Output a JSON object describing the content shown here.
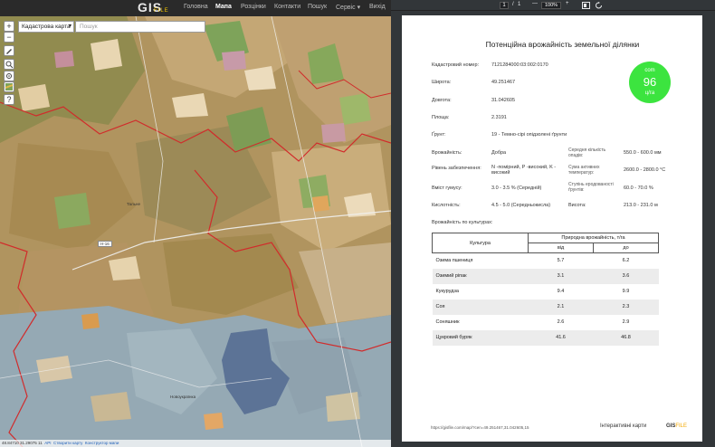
{
  "nav": {
    "logo_main": "GIS",
    "logo_sub": "FILE",
    "items": [
      {
        "label": "Головна"
      },
      {
        "label": "Мапа"
      },
      {
        "label": "Розцінки"
      },
      {
        "label": "Контакти"
      },
      {
        "label": "Пошук"
      },
      {
        "label": "Сервіс"
      },
      {
        "label": "Вихід"
      }
    ],
    "service_chevron": "▾"
  },
  "map": {
    "layer_select": "Кадастрова карта",
    "search_placeholder": "Пошук",
    "zoom_in": "+",
    "zoom_out": "−",
    "help": "?",
    "road_label": "Н-16",
    "place_labels": [
      "Тальне",
      "Новоукраїнка"
    ],
    "attribution": {
      "coords": "48.84710 31.29075 11",
      "api": "API",
      "create_map": "Створити карту",
      "builder": "Конструктор мапи"
    }
  },
  "pdf_toolbar": {
    "page_current": "1",
    "page_sep": "/",
    "page_total": "1",
    "zoom_minus": "—",
    "zoom": "100%",
    "zoom_plus": "+"
  },
  "report": {
    "title": "Потенційна врожайність земельної ділянки",
    "cadastral_label": "Кадастровий номер:",
    "cadastral_value": "7121284000:03:002:0170",
    "lat_label": "Широта:",
    "lat_value": "49.251467",
    "lon_label": "Довгота:",
    "lon_value": "31.042605",
    "area_label": "Площа:",
    "area_value": "2.3191",
    "soil_label": "Ґрунт:",
    "soil_value": "19 - Темно-сірі опідзолені ґрунти",
    "fertility_label": "Врожайність:",
    "fertility_value": "Добра",
    "precip_label": "Середня кількість опадів:",
    "precip_value": "550.0 - 600.0 мм",
    "supply_label": "Рівень забезпечення:",
    "supply_value": "N -помірний, P -високий, K - високий",
    "temp_label": "Сума активних температур:",
    "temp_value": "2600.0 - 2800.0 °C",
    "humus_label": "Вміст гумусу:",
    "humus_value": "3.0 - 3.5 % (Середній)",
    "erosion_label": "Ступінь еродованості ґрунтів:",
    "erosion_value": "60.0 - 70.0 %",
    "acidity_label": "Кислотність:",
    "acidity_value": "4.5 - 5.0 (Середньокисла)",
    "height_label": "Висота:",
    "height_value": "213.0 - 231.0 м",
    "crops_heading": "Врожайність по культурах:",
    "badge": {
      "top": "com",
      "value": "96",
      "bottom": "ц/га"
    },
    "table": {
      "col_crop": "Культура",
      "col_group": "Природна врожайність, т/га",
      "col_from": "від",
      "col_to": "до",
      "rows": [
        {
          "crop": "Озима пшениця",
          "from": "5.7",
          "to": "6.2"
        },
        {
          "crop": "Озимий ріпак",
          "from": "3.1",
          "to": "3.6"
        },
        {
          "crop": "Кукурудза",
          "from": "9.4",
          "to": "9.9"
        },
        {
          "crop": "Соя",
          "from": "2.1",
          "to": "2.3"
        },
        {
          "crop": "Соняшник",
          "from": "2.6",
          "to": "2.9"
        },
        {
          "crop": "Цукровий буряк",
          "from": "41.6",
          "to": "46.8"
        }
      ]
    },
    "footer_url": "https://gisfile.com/map/?cen=49.251467,31.042605,15",
    "footer_text": "Інтерактивні карти",
    "footer_logo_main": "GIS",
    "footer_logo_sub": "FILE"
  },
  "colors": {
    "nav_bg": "#2a2a2a",
    "brand_yellow": "#f3c400",
    "badge_green": "#3ce43f",
    "pdf_bg": "#323639",
    "parcel_border": "#d12b2b",
    "lowland_blue": "#95a9b4"
  }
}
